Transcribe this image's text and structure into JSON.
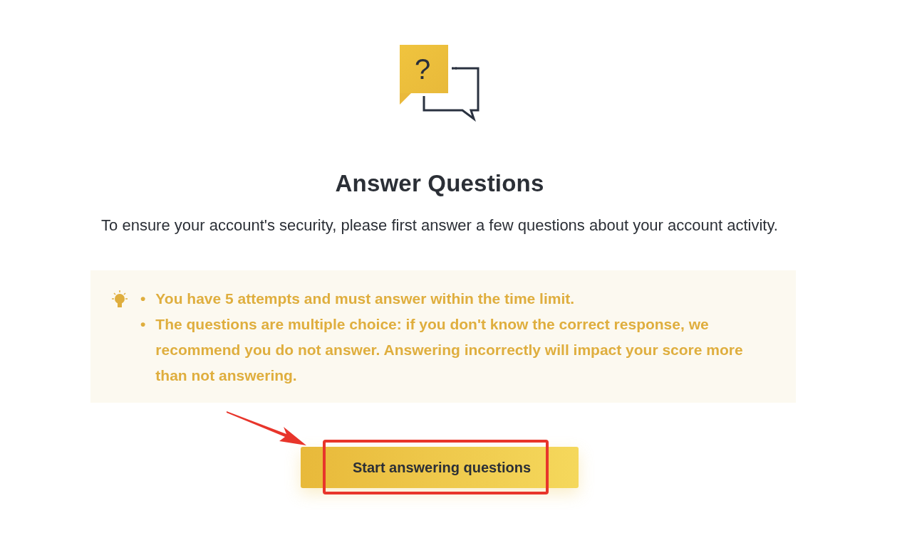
{
  "icon_glyph": "?",
  "title": "Answer Questions",
  "description": "To ensure your account's security, please first answer a few questions about your account activity.",
  "notice": {
    "bullet": "•",
    "items": [
      "You have **5** attempts and must answer within the time limit.",
      "The questions are multiple choice: if you don't know the correct response, we recommend you do not answer. Answering incorrectly will impact your score more than not answering."
    ]
  },
  "button": {
    "label": "Start answering questions",
    "highlighted": true
  },
  "annotation_arrow": true
}
